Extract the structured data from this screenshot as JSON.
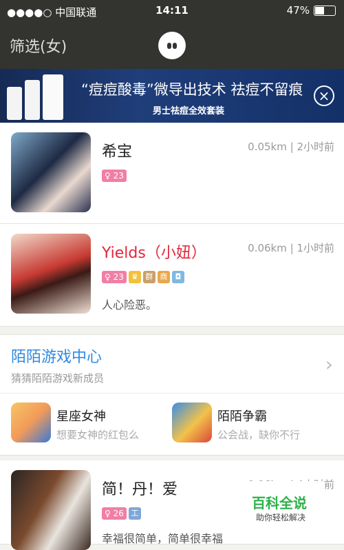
{
  "status": {
    "carrier": "●●●●○ 中国联通",
    "time": "14:11",
    "battery": "47%"
  },
  "nav": {
    "title": "筛选(女)"
  },
  "banner": {
    "headline": "“痘痘酸毒”微导出技术 祛痘不留痕",
    "sub": "男士祛痘全效套装",
    "close_icon": "close-icon"
  },
  "users": [
    {
      "name": "希宝",
      "meta": "0.05km | 2小时前",
      "age": "23",
      "signature": ""
    },
    {
      "name": "Yields（小妞）",
      "meta": "0.06km | 1小时前",
      "age": "23",
      "tags": [
        "群",
        "商"
      ],
      "signature": "人心险恶。"
    },
    {
      "name": "简！丹！爱",
      "meta": "0.06km | 4小时前",
      "age": "26",
      "tags": [
        "工"
      ],
      "signature": "幸福很简单，简单很幸福"
    }
  ],
  "game_center": {
    "title": "陌陌游戏中心",
    "subtitle": "猜猜陌陌游戏新成员",
    "games": [
      {
        "name": "星座女神",
        "desc": "想要女神的红包么"
      },
      {
        "name": "陌陌争霸",
        "desc": "公会战，缺你不行"
      }
    ]
  },
  "watermark": {
    "title": "百科全说",
    "sub": "助你轻松解决"
  }
}
